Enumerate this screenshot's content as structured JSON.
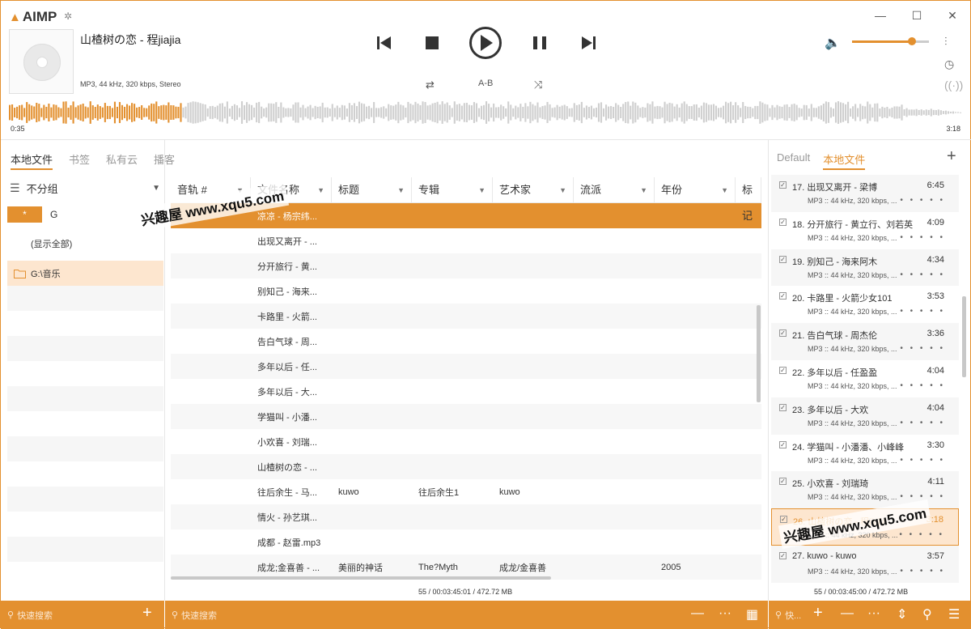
{
  "app": {
    "name": "AIMP"
  },
  "now_playing": {
    "title": "山楂树の恋 - 程jiajia",
    "info": "MP3, 44 kHz, 320 kbps, Stereo",
    "time_elapsed": "0:35",
    "time_total": "3:18",
    "progress": 0.18
  },
  "controls": {
    "ab_label": "A-B"
  },
  "volume": {
    "level": 0.78
  },
  "tabs": [
    "本地文件",
    "书签",
    "私有云",
    "播客"
  ],
  "right_tabs": [
    "Default",
    "本地文件"
  ],
  "left": {
    "group_label": "不分组",
    "star_label": "*",
    "drive_label": "G",
    "show_all": "(显示全部)",
    "folder": "G:\\音乐"
  },
  "columns": [
    "音轨 #",
    "文件名称",
    "标题",
    "专辑",
    "艺术家",
    "流派",
    "年份",
    "标记"
  ],
  "rows": [
    [
      "",
      "凉凉 - 杨宗纬...",
      "",
      "",
      "",
      "",
      ""
    ],
    [
      "",
      "出现又离开 - ...",
      "",
      "",
      "",
      "",
      ""
    ],
    [
      "",
      "分开旅行 - 黄...",
      "",
      "",
      "",
      "",
      ""
    ],
    [
      "",
      "别知己 - 海来...",
      "",
      "",
      "",
      "",
      ""
    ],
    [
      "",
      "卡路里 - 火箭...",
      "",
      "",
      "",
      "",
      ""
    ],
    [
      "",
      "告白气球 - 周...",
      "",
      "",
      "",
      "",
      ""
    ],
    [
      "",
      "多年以后 - 任...",
      "",
      "",
      "",
      "",
      ""
    ],
    [
      "",
      "多年以后 - 大...",
      "",
      "",
      "",
      "",
      ""
    ],
    [
      "",
      "学猫叫 - 小潘...",
      "",
      "",
      "",
      "",
      ""
    ],
    [
      "",
      "小欢喜 - 刘瑞...",
      "",
      "",
      "",
      "",
      ""
    ],
    [
      "",
      "山楂树の恋 - ...",
      "",
      "",
      "",
      "",
      ""
    ],
    [
      "",
      "往后余生 - 马...",
      "kuwo",
      "往后余生1",
      "kuwo",
      "",
      ""
    ],
    [
      "",
      "情火 - 孙艺琪...",
      "",
      "",
      "",
      "",
      ""
    ],
    [
      "",
      "成都 - 赵雷.mp3",
      "",
      "",
      "",
      "",
      ""
    ],
    [
      "",
      "成龙;金喜善 - ...",
      "美丽的神话",
      "The?Myth",
      "成龙/金喜善",
      "",
      "2005"
    ]
  ],
  "mid_status": "55 / 00:03:45:01 / 472.72 MB",
  "playlist": [
    {
      "title": "17. 出现又离开 - 梁博",
      "dur": "6:45"
    },
    {
      "title": "18. 分开旅行 - 黄立行、刘若英",
      "dur": "4:09"
    },
    {
      "title": "19. 别知己 - 海来阿木",
      "dur": "4:34"
    },
    {
      "title": "20. 卡路里 - 火箭少女101",
      "dur": "3:53"
    },
    {
      "title": "21. 告白气球 - 周杰伦",
      "dur": "3:36"
    },
    {
      "title": "22. 多年以后 - 任盈盈",
      "dur": "4:04"
    },
    {
      "title": "23. 多年以后 - 大欢",
      "dur": "4:04"
    },
    {
      "title": "24. 学猫叫 - 小潘潘、小峰峰",
      "dur": "3:30"
    },
    {
      "title": "25. 小欢喜 - 刘瑞琦",
      "dur": "4:11"
    },
    {
      "title": "26. 山楂树の恋 - 程jiajia",
      "dur": "3:18"
    },
    {
      "title": "27. kuwo - kuwo",
      "dur": "3:57"
    }
  ],
  "playlist_meta": "MP3 :: 44 kHz, 320 kbps, ...",
  "playlist_dots": "• • • • •",
  "right_status": "55 / 00:03:45:00 / 472.72 MB",
  "search_placeholder": "快速搜索",
  "search_placeholder_short": "快...",
  "watermark": "兴趣屋 www.xqu5.com",
  "colors": {
    "accent": "#e3902f",
    "selected_bg": "#fde6cf"
  }
}
